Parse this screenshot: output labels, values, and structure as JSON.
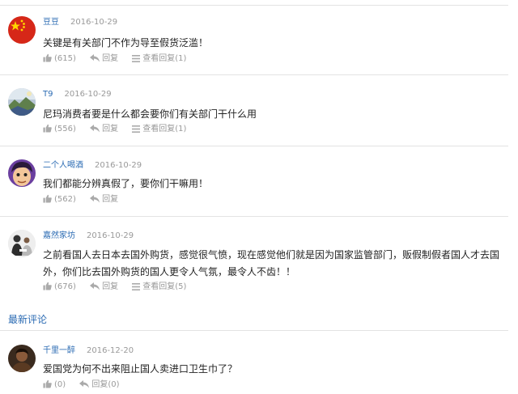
{
  "comments": [
    {
      "user": "豆豆",
      "date": "2016-10-29",
      "text": "关键是有关部门不作为导至假货泛滥！",
      "like_count": "(615)",
      "reply_label": "回复",
      "view_replies_label": "查看回复(1)",
      "avatar_icon": "china-flag-icon"
    },
    {
      "user": "T9",
      "date": "2016-10-29",
      "text": "尼玛消费者要是什么都会要你们有关部门干什么用",
      "like_count": "(556)",
      "reply_label": "回复",
      "view_replies_label": "查看回复(1)",
      "avatar_icon": "landscape-icon"
    },
    {
      "user": "二个人喝酒",
      "date": "2016-10-29",
      "text": "我们都能分辨真假了，要你们干嘛用！",
      "like_count": "(562)",
      "reply_label": "回复",
      "avatar_icon": "cartoon-face-icon"
    },
    {
      "user": "嘉然家坊",
      "date": "2016-10-29",
      "text": "之前看国人去日本去国外购货，感觉很气愤，现在感觉他们就是因为国家监管部门，贩假制假者国人才去国外，你们比去国外购货的国人更令人气氛，最令人不齿！！",
      "like_count": "(676)",
      "reply_label": "回复",
      "view_replies_label": "查看回复(5)",
      "avatar_icon": "people-photo-icon"
    }
  ],
  "latest_section": {
    "title": "最新评论",
    "comments": [
      {
        "user": "千里一醉",
        "date": "2016-12-20",
        "text": "爱国党为何不出来阻止国人卖进口卫生巾了？",
        "like_count": "(0)",
        "reply_label": "回复(0)",
        "avatar_icon": "dark-portrait-icon"
      }
    ]
  },
  "colors": {
    "username": "#2b6bb3",
    "meta": "#999999",
    "divider": "#e3e3e3",
    "text": "#222222"
  }
}
